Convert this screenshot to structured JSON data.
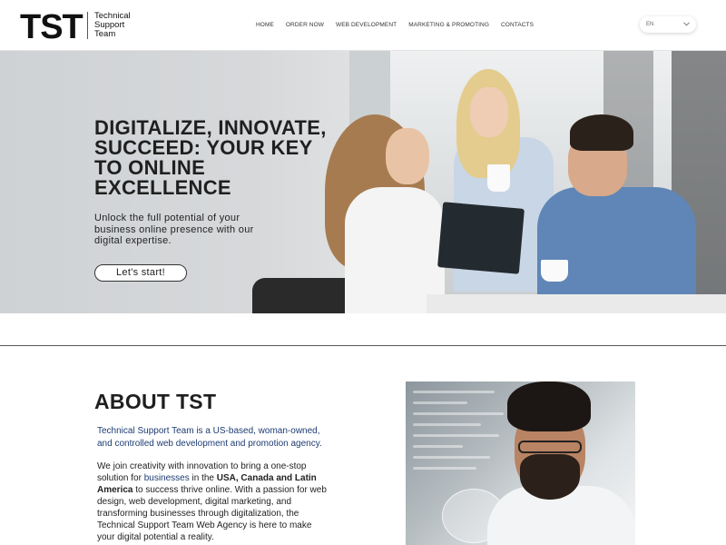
{
  "header": {
    "logo_mark": "TST",
    "logo_text": [
      "Technical",
      "Support",
      "Team"
    ],
    "nav": [
      "HOME",
      "ORDER NOW",
      "WEB DEVELOPMENT",
      "MARKETING & PROMOTING",
      "CONTACTS"
    ],
    "language": "EN"
  },
  "hero": {
    "title": "DIGITALIZE, INNOVATE, SUCCEED: YOUR KEY TO ONLINE EXCELLENCE",
    "subtitle": "Unlock the full potential of your business online presence with our digital expertise.",
    "cta": "Let's start!"
  },
  "about": {
    "title": "ABOUT TST",
    "lead": "Technical Support Team is a US-based, woman-owned, and controlled web development and promotion agency.",
    "body_1": "We join creativity with innovation to bring a one-stop solution for",
    "body_link": "businesses",
    "body_2": "in the",
    "body_bold": "USA, Canada and Latin America",
    "body_3": "to success thrive online. With a passion for web design, web development, digital marketing, and transforming businesses through digitalization, the Technical Support Team Web Agency is here to make your digital potential a reality."
  },
  "colors": {
    "accent_blue": "#1d3c73",
    "text": "#1f1f1f"
  }
}
